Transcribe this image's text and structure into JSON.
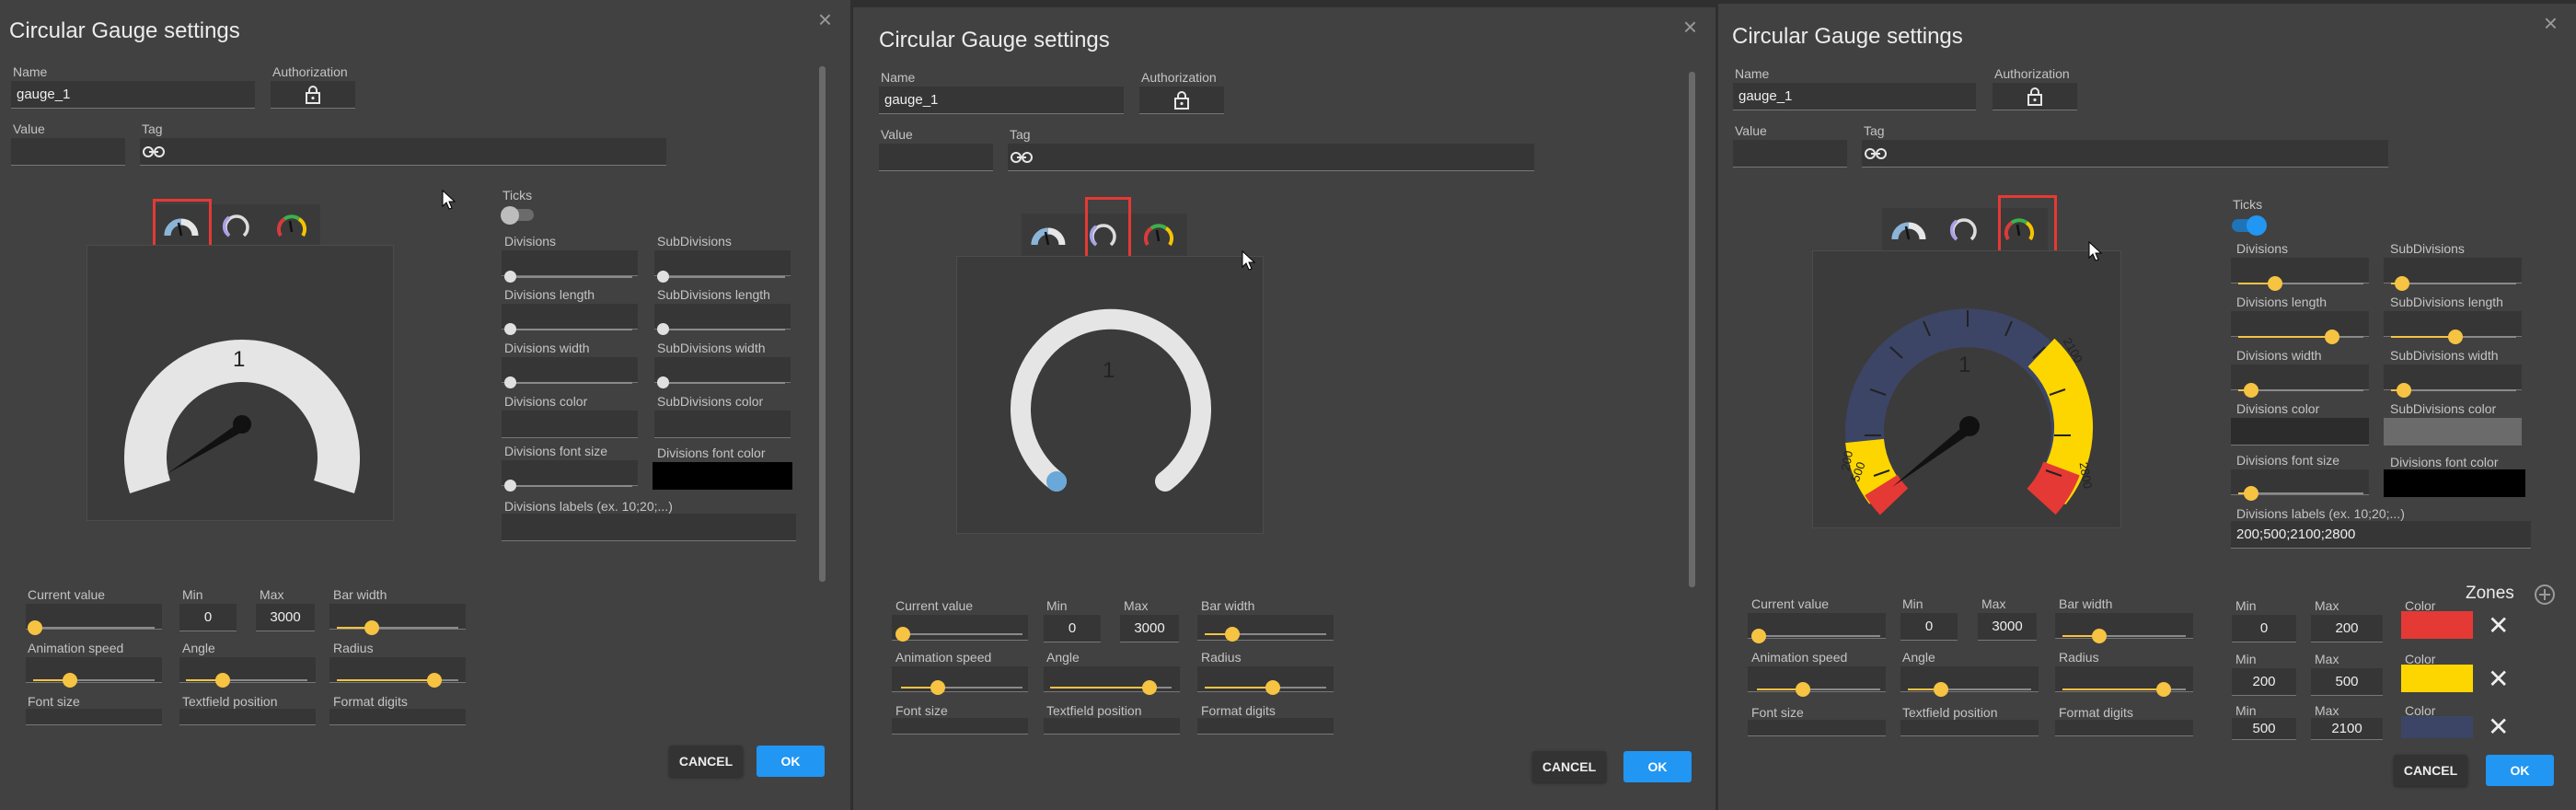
{
  "dialog": {
    "title": "Circular Gauge settings",
    "close_glyph": "×",
    "name_label": "Name",
    "name_value": "gauge_1",
    "authorization_label": "Authorization",
    "value_label": "Value",
    "tag_label": "Tag",
    "cancel_label": "CANCEL",
    "ok_label": "OK"
  },
  "ticks": {
    "ticks_label": "Ticks",
    "divisions": "Divisions",
    "subdivisions": "SubDivisions",
    "divisions_length": "Divisions length",
    "subdivisions_length": "SubDivisions length",
    "divisions_width": "Divisions width",
    "subdivisions_width": "SubDivisions width",
    "divisions_color": "Divisions color",
    "subdivisions_color": "SubDivisions color",
    "divisions_font_size": "Divisions font size",
    "divisions_font_color": "Divisions font color",
    "divisions_labels": "Divisions labels (ex. 10;20;...)",
    "labels_value_3": "200;500;2100;2800"
  },
  "props": {
    "current_value": "Current value",
    "min": "Min",
    "max": "Max",
    "min_value": "0",
    "max_value": "3000",
    "bar_width": "Bar width",
    "animation_speed": "Animation speed",
    "angle": "Angle",
    "radius": "Radius",
    "font_size": "Font size",
    "textfield_position": "Textfield position",
    "format_digits": "Format digits"
  },
  "gauge": {
    "value_text": "1"
  },
  "zones": {
    "title": "Zones",
    "min_label": "Min",
    "max_label": "Max",
    "color_label": "Color",
    "remove_glyph": "✕",
    "rows": [
      {
        "min": "0",
        "max": "200",
        "color": "#e53935"
      },
      {
        "min": "200",
        "max": "500",
        "color": "#fdd600"
      },
      {
        "min": "500",
        "max": "2100",
        "color": "#3c4565"
      }
    ]
  },
  "gauge_labels": [
    "200",
    "500",
    "2100",
    "2800"
  ],
  "colors": {
    "accent": "#2196f3",
    "slider": "#f6c342",
    "highlight": "#e53935"
  },
  "icons": {
    "close": "close-icon",
    "lock": "lock-icon",
    "link": "link-icon",
    "gauge_types": [
      "gauge-type-standard-icon",
      "gauge-type-donut-icon",
      "gauge-type-zones-icon"
    ],
    "add": "add-icon"
  }
}
